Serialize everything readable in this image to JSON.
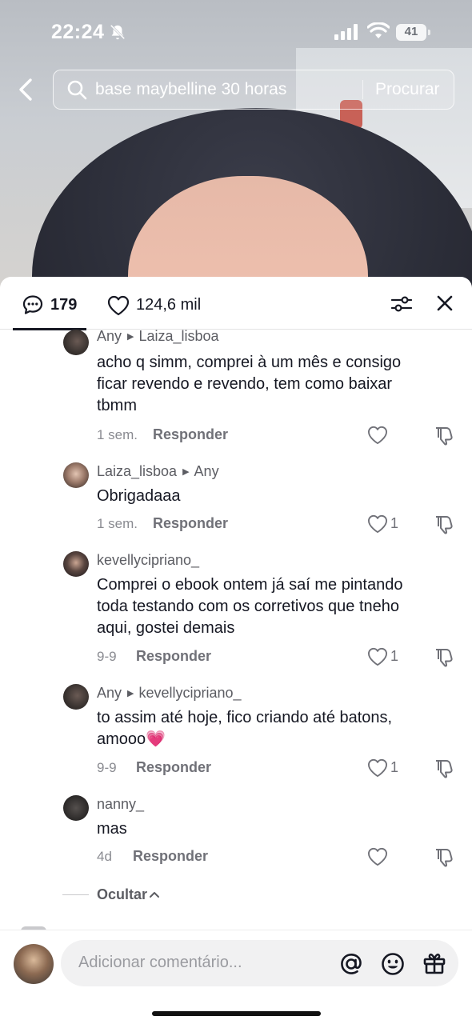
{
  "status_bar": {
    "time": "22:24",
    "battery": "41"
  },
  "search": {
    "query": "base maybelline 30 horas",
    "submit_label": "Procurar"
  },
  "sheet": {
    "comment_count": "179",
    "like_count": "124,6 mil"
  },
  "comments": [
    {
      "username": "Any",
      "reply_to": "Laiza_lisboa",
      "text": "acho q simm, comprei à um mês e consigo ficar revendo e revendo, tem como baixar tbmm",
      "date": "1 sem.",
      "reply_label": "Responder",
      "likes": ""
    },
    {
      "username": "Laiza_lisboa",
      "reply_to": "Any",
      "text": "Obrigadaaa",
      "date": "1 sem.",
      "reply_label": "Responder",
      "likes": "1"
    },
    {
      "username": "kevellycipriano_",
      "reply_to": "",
      "text": "Comprei o ebook ontem já saí me pintando toda testando com os corretivos que tneho aqui, gostei demais",
      "date": "9-9",
      "reply_label": "Responder",
      "likes": "1"
    },
    {
      "username": "Any",
      "reply_to": "kevellycipriano_",
      "text": "to assim até hoje, fico criando até batons, amooo💗",
      "date": "9-9",
      "reply_label": "Responder",
      "likes": "1"
    },
    {
      "username": "nanny_",
      "reply_to": "",
      "text": "mas",
      "date": "4d",
      "reply_label": "Responder",
      "likes": ""
    }
  ],
  "hide_label": "Ocultar",
  "composer": {
    "placeholder": "Adicionar comentário..."
  },
  "colors": {
    "text": "#161823",
    "muted": "#8a8b91",
    "pink_heart": "#f25aa8"
  },
  "icons": [
    "back-icon",
    "search-icon",
    "comment-icon",
    "heart-icon",
    "filter-icon",
    "close-icon",
    "dislike-icon",
    "at-icon",
    "emoji-icon",
    "gift-icon",
    "bell-off-icon",
    "signal-icon",
    "wifi-icon",
    "battery-icon"
  ]
}
